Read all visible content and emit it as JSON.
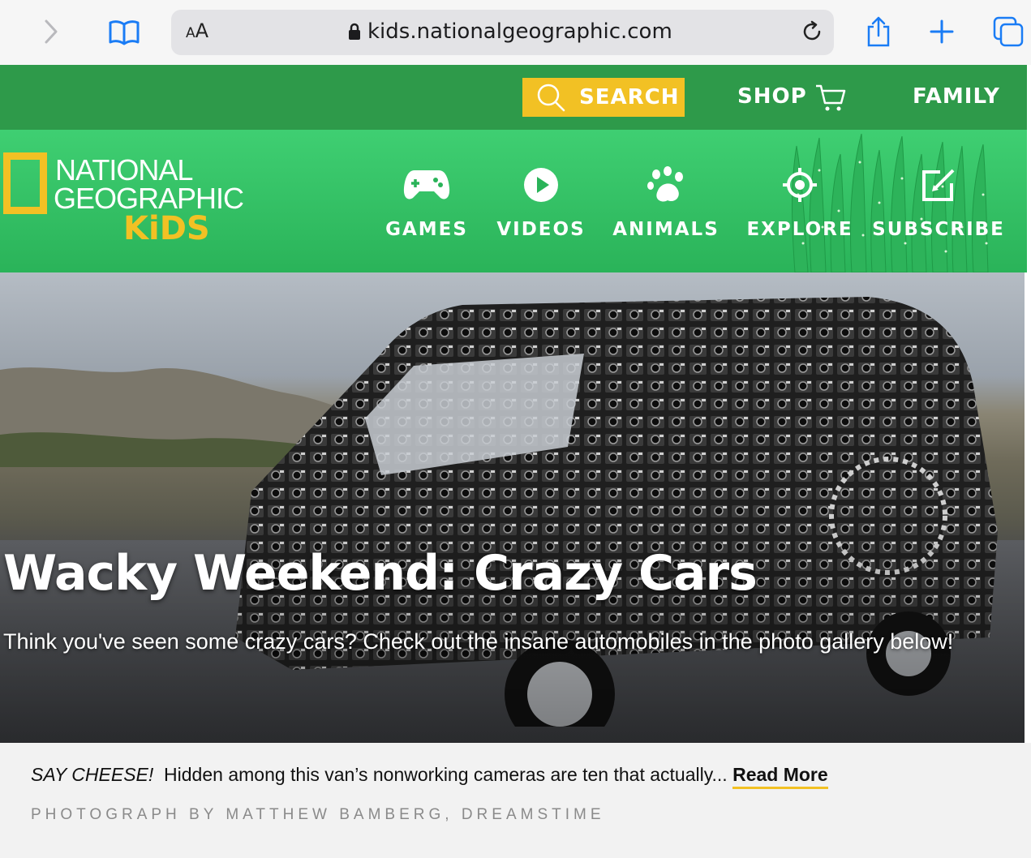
{
  "browser": {
    "text_size_small": "A",
    "text_size_large": "A",
    "url": "kids.nationalgeographic.com"
  },
  "topbar": {
    "search_label": "SEARCH",
    "shop_label": "SHOP",
    "family_label": "FAMILY"
  },
  "logo": {
    "line1": "NATIONAL",
    "line2": "GEOGRAPHIC",
    "line3": "KiDS"
  },
  "nav": {
    "items": [
      {
        "label": "GAMES",
        "icon": "gamepad-icon"
      },
      {
        "label": "VIDEOS",
        "icon": "play-icon"
      },
      {
        "label": "ANIMALS",
        "icon": "paw-icon"
      },
      {
        "label": "EXPLORE",
        "icon": "target-icon"
      },
      {
        "label": "SUBSCRIBE",
        "icon": "edit-icon"
      }
    ]
  },
  "hero": {
    "title": "Wacky Weekend: Crazy Cars",
    "subtitle": "Think you've seen some crazy cars? Check out the insane automobiles in the photo gallery below!"
  },
  "caption": {
    "lead": "SAY CHEESE!",
    "text": "Hidden among this van’s nonworking cameras are ten that actually...",
    "read_more": "Read More",
    "credit": "PHOTOGRAPH BY MATTHEW BAMBERG, DREAMSTIME"
  },
  "colors": {
    "topbar_green": "#2e9a4a",
    "nav_green": "#3fcf72",
    "accent_yellow": "#f2c124",
    "browser_blue": "#1a7cf5"
  }
}
